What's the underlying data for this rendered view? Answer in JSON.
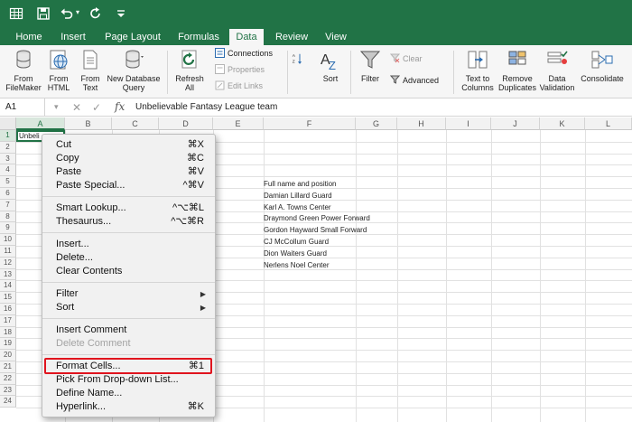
{
  "app": {
    "accent": "#217346",
    "highlight_color": "#e0141e"
  },
  "quick_access": {
    "icons": [
      "grid-icon",
      "save-icon",
      "undo-icon",
      "redo-icon",
      "customize-icon"
    ]
  },
  "ribbon_tabs": [
    "Home",
    "Insert",
    "Page Layout",
    "Formulas",
    "Data",
    "Review",
    "View"
  ],
  "active_tab": "Data",
  "ribbon": {
    "from_filemaker": "From\nFileMaker",
    "from_html": "From\nHTML",
    "from_text": "From\nText",
    "new_db_query": "New Database\nQuery",
    "refresh_all": "Refresh\nAll",
    "connections": "Connections",
    "properties": "Properties",
    "edit_links": "Edit Links",
    "sort": "Sort",
    "filter": "Filter",
    "clear": "Clear",
    "advanced": "Advanced",
    "text_to_columns": "Text to\nColumns",
    "remove_duplicates": "Remove\nDuplicates",
    "data_validation": "Data\nValidation",
    "consolidate": "Consolidate"
  },
  "formula_bar": {
    "name_box": "A1",
    "fx": "fx",
    "content": "Unbelievable Fantasy League team"
  },
  "columns": [
    "A",
    "B",
    "C",
    "D",
    "E",
    "F",
    "G",
    "H",
    "I",
    "J",
    "K",
    "L"
  ],
  "rows": [
    "1",
    "2",
    "3",
    "4",
    "5",
    "6",
    "7",
    "8",
    "9",
    "10",
    "11",
    "12",
    "13",
    "14",
    "15",
    "16",
    "17",
    "18",
    "19",
    "20",
    "21",
    "22",
    "23",
    "24"
  ],
  "cells": {
    "a1": "Unbeli",
    "f_column": [
      "Full name and position",
      "Damian Lillard Guard",
      "Karl A. Towns Center",
      "Draymond Green Power Forward",
      "Gordon Hayward Small Forward",
      "CJ McCollum Guard",
      "Dion Waiters Guard",
      "Nerlens Noel Center"
    ]
  },
  "context_menu": {
    "items": [
      {
        "label": "Cut",
        "shortcut": "⌘X"
      },
      {
        "label": "Copy",
        "shortcut": "⌘C"
      },
      {
        "label": "Paste",
        "shortcut": "⌘V"
      },
      {
        "label": "Paste Special...",
        "shortcut": "^⌘V"
      },
      {
        "label": "Smart Lookup...",
        "shortcut": "^⌥⌘L"
      },
      {
        "label": "Thesaurus...",
        "shortcut": "^⌥⌘R"
      },
      {
        "label": "Insert...",
        "shortcut": ""
      },
      {
        "label": "Delete...",
        "shortcut": ""
      },
      {
        "label": "Clear Contents",
        "shortcut": ""
      },
      {
        "label": "Filter",
        "shortcut": ""
      },
      {
        "label": "Sort",
        "shortcut": ""
      },
      {
        "label": "Insert Comment",
        "shortcut": ""
      },
      {
        "label": "Delete Comment",
        "shortcut": ""
      },
      {
        "label": "Format Cells...",
        "shortcut": "⌘1"
      },
      {
        "label": "Pick From Drop-down List...",
        "shortcut": ""
      },
      {
        "label": "Define Name...",
        "shortcut": ""
      },
      {
        "label": "Hyperlink...",
        "shortcut": "⌘K"
      }
    ]
  }
}
